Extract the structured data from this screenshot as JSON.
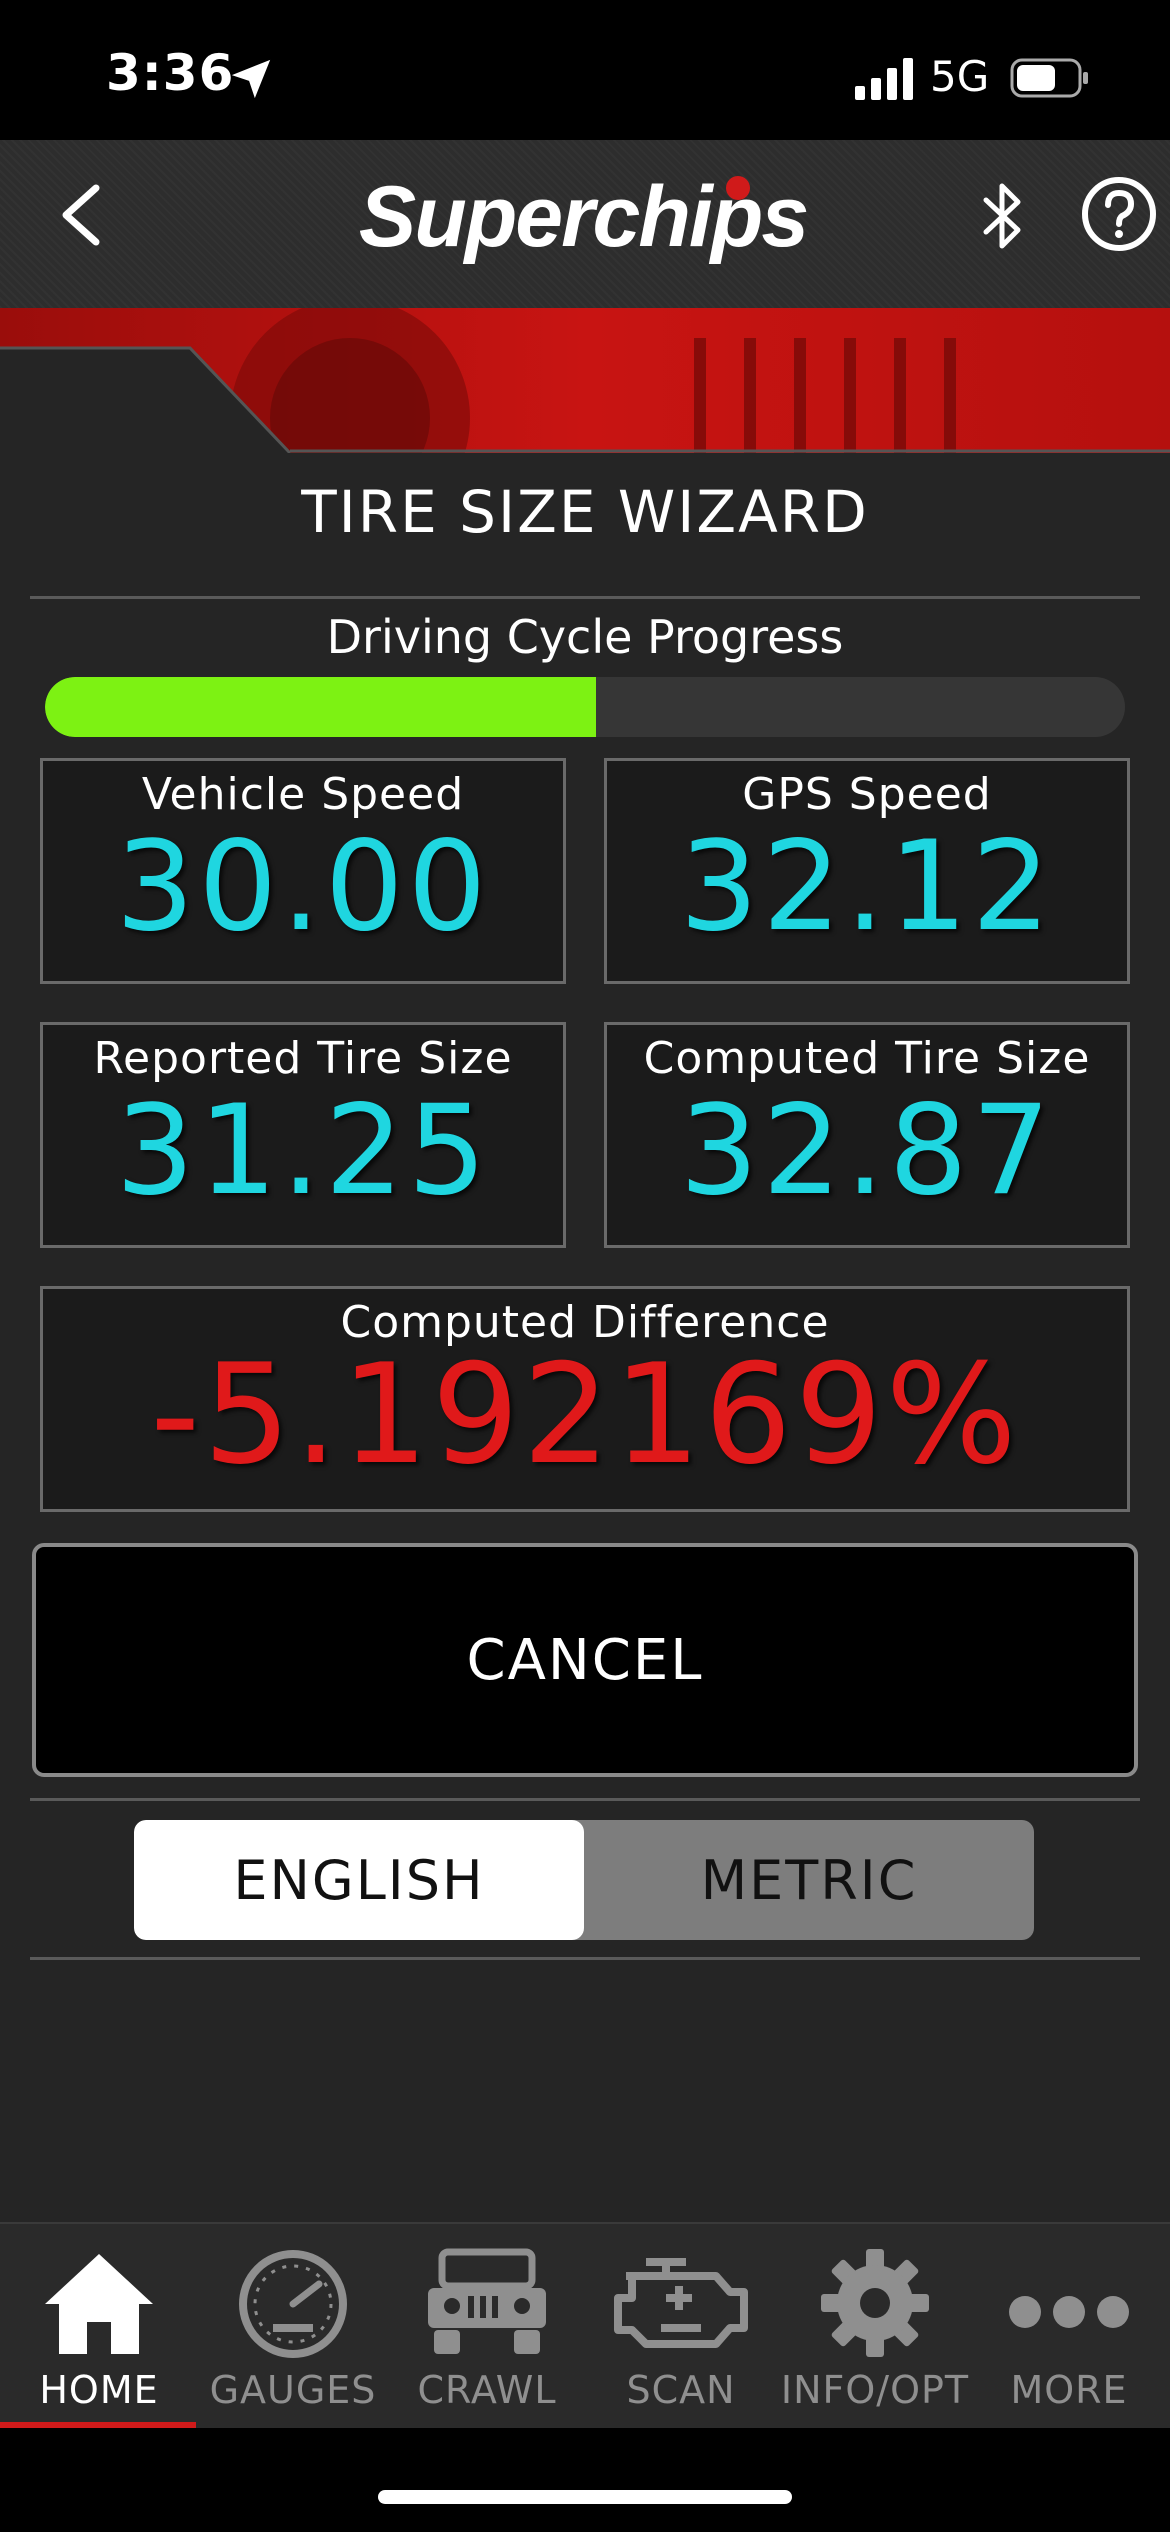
{
  "status_bar": {
    "time": "3:36",
    "network": "5G"
  },
  "header": {
    "logo_text": "Superchips"
  },
  "page": {
    "title": "TIRE SIZE WIZARD"
  },
  "progress": {
    "label": "Driving Cycle Progress",
    "fraction": 0.51,
    "color": "#7df213"
  },
  "tiles": {
    "vehicle_speed": {
      "label": "Vehicle Speed",
      "value": "30.00"
    },
    "gps_speed": {
      "label": "GPS Speed",
      "value": "32.12"
    },
    "reported_tire": {
      "label": "Reported Tire Size",
      "value": "31.25"
    },
    "computed_tire": {
      "label": "Computed Tire Size",
      "value": "32.87"
    },
    "difference": {
      "label": "Computed Difference",
      "value": "-5.192169%"
    }
  },
  "actions": {
    "cancel_label": "CANCEL"
  },
  "units": {
    "selected": "ENGLISH",
    "options": [
      "ENGLISH",
      "METRIC"
    ]
  },
  "tabs": [
    {
      "label": "HOME",
      "icon": "home-icon",
      "active": true
    },
    {
      "label": "GAUGES",
      "icon": "gauge-icon",
      "active": false
    },
    {
      "label": "CRAWL",
      "icon": "jeep-icon",
      "active": false
    },
    {
      "label": "SCAN",
      "icon": "engine-icon",
      "active": false
    },
    {
      "label": "INFO/OPT",
      "icon": "gear-icon",
      "active": false
    },
    {
      "label": "MORE",
      "icon": "more-icon",
      "active": false
    }
  ],
  "colors": {
    "value_cyan": "#1fd6e0",
    "value_red": "#e0191a",
    "brand_red": "#c0120f",
    "active_tab_underline": "#d01a1a"
  }
}
